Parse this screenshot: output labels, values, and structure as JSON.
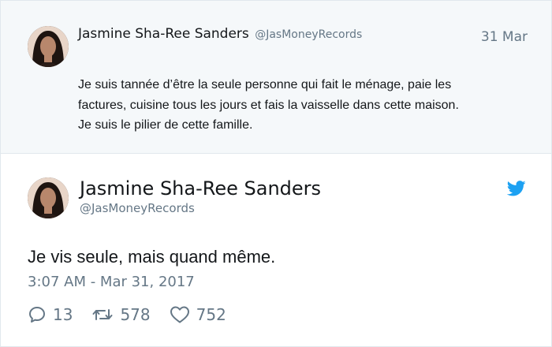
{
  "parent_tweet": {
    "author_name": "Jasmine Sha-Ree Sanders",
    "author_handle": "@JasMoneyRecords",
    "date": "31 Mar",
    "text_lines": [
      "Je suis tannée d’être la seule personne qui fait le ménage, paie les",
      "factures, cuisine tous les jours et fais la vaisselle dans cette maison.",
      "Je suis le pilier de cette famille."
    ],
    "avatar_icon": "profile-photo"
  },
  "main_tweet": {
    "author_name": "Jasmine Sha-Ree Sanders",
    "author_handle": "@JasMoneyRecords",
    "text": "Je vis seule, mais quand même.",
    "timestamp": "3:07 AM - Mar 31, 2017",
    "avatar_icon": "profile-photo",
    "brand_icon": "twitter-bird-icon",
    "actions": [
      {
        "icon": "reply-icon",
        "count": "13"
      },
      {
        "icon": "retweet-icon",
        "count": "578"
      },
      {
        "icon": "like-icon",
        "count": "752"
      }
    ]
  },
  "colors": {
    "brand": "#1da1f2",
    "parent_background": "#f5f8fa",
    "secondary_text": "#657786",
    "primary_text": "#14171a",
    "border": "#e1e8ed"
  }
}
